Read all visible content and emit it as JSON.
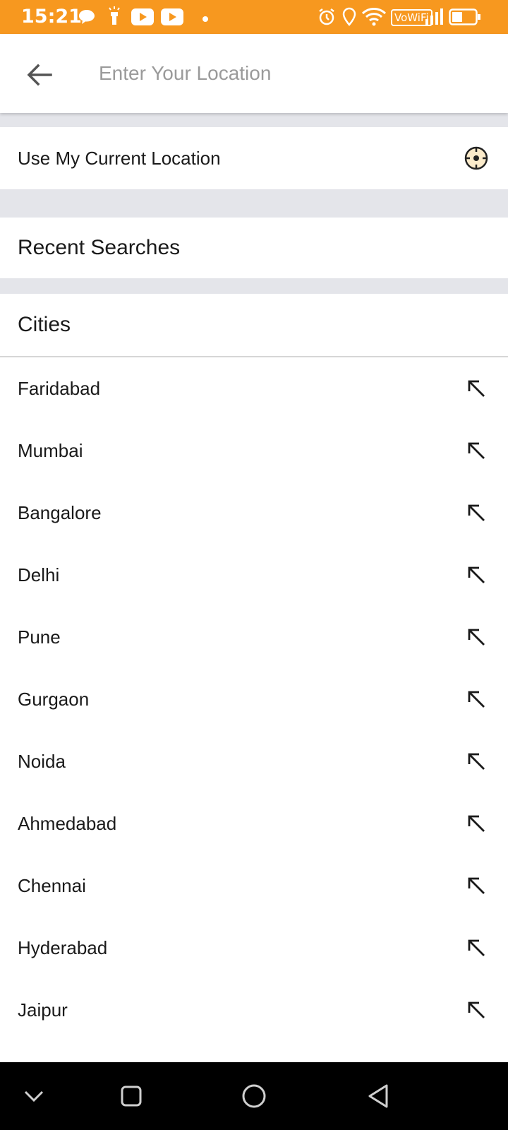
{
  "status_bar": {
    "time": "15:21",
    "vowifi": "VoWiFi",
    "icons": [
      "chat-bubble-icon",
      "flashlight-icon",
      "youtube-icon",
      "youtube-icon",
      "dot-icon",
      "alarm-icon",
      "location-pin-icon",
      "wifi-icon",
      "signal-icon",
      "battery-icon"
    ],
    "bg_color": "#F7981F"
  },
  "search": {
    "placeholder": "Enter Your Location",
    "value": ""
  },
  "current_location": {
    "label": "Use My Current Location",
    "icon": "crosshair-icon"
  },
  "recent": {
    "title": "Recent Searches"
  },
  "cities": {
    "title": "Cities",
    "items": [
      {
        "name": "Faridabad"
      },
      {
        "name": "Mumbai"
      },
      {
        "name": "Bangalore"
      },
      {
        "name": "Delhi"
      },
      {
        "name": "Pune"
      },
      {
        "name": "Gurgaon"
      },
      {
        "name": "Noida"
      },
      {
        "name": "Ahmedabad"
      },
      {
        "name": "Chennai"
      },
      {
        "name": "Hyderabad"
      },
      {
        "name": "Jaipur"
      }
    ]
  },
  "nav_bar": {
    "buttons": [
      "chevron-down-icon",
      "recents-square-icon",
      "home-circle-icon",
      "back-triangle-icon"
    ]
  }
}
